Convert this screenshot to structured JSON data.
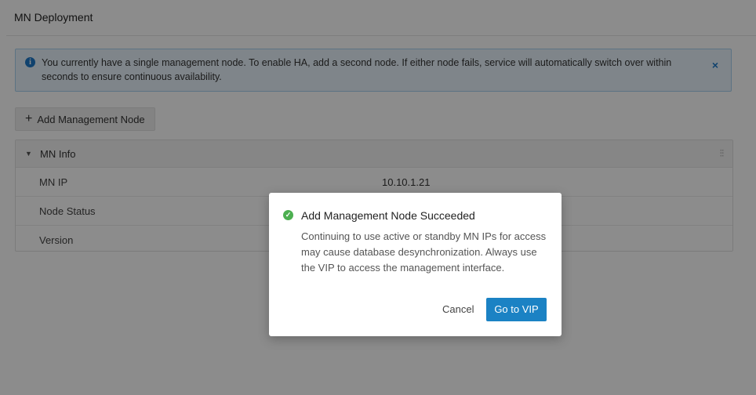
{
  "header": {
    "title": "MN Deployment"
  },
  "alert": {
    "message": "You currently have a single management node. To enable HA, add a second node. If either node fails, service will automatically switch over within seconds to ensure continuous availability.",
    "close_glyph": "×",
    "icon": "info-icon"
  },
  "toolbar": {
    "add_plus": "+",
    "add_label": "Add Management Node"
  },
  "panel": {
    "title": "MN Info",
    "caret": "▼",
    "drag": "⁝⁝",
    "rows": [
      {
        "key": "MN IP",
        "value": "10.10.1.21"
      },
      {
        "key": "Node Status",
        "value": ""
      },
      {
        "key": "Version",
        "value": ""
      }
    ]
  },
  "modal": {
    "icon_glyph": "✓",
    "title": "Add Management Node Succeeded",
    "body": "Continuing to use active or standby MN IPs for access may cause database desynchronization. Always use the VIP to access the management interface.",
    "cancel_label": "Cancel",
    "confirm_label": "Go to VIP"
  },
  "colors": {
    "accent": "#1b82c4",
    "success": "#4caf50",
    "info_bg": "#e7f3fb"
  }
}
